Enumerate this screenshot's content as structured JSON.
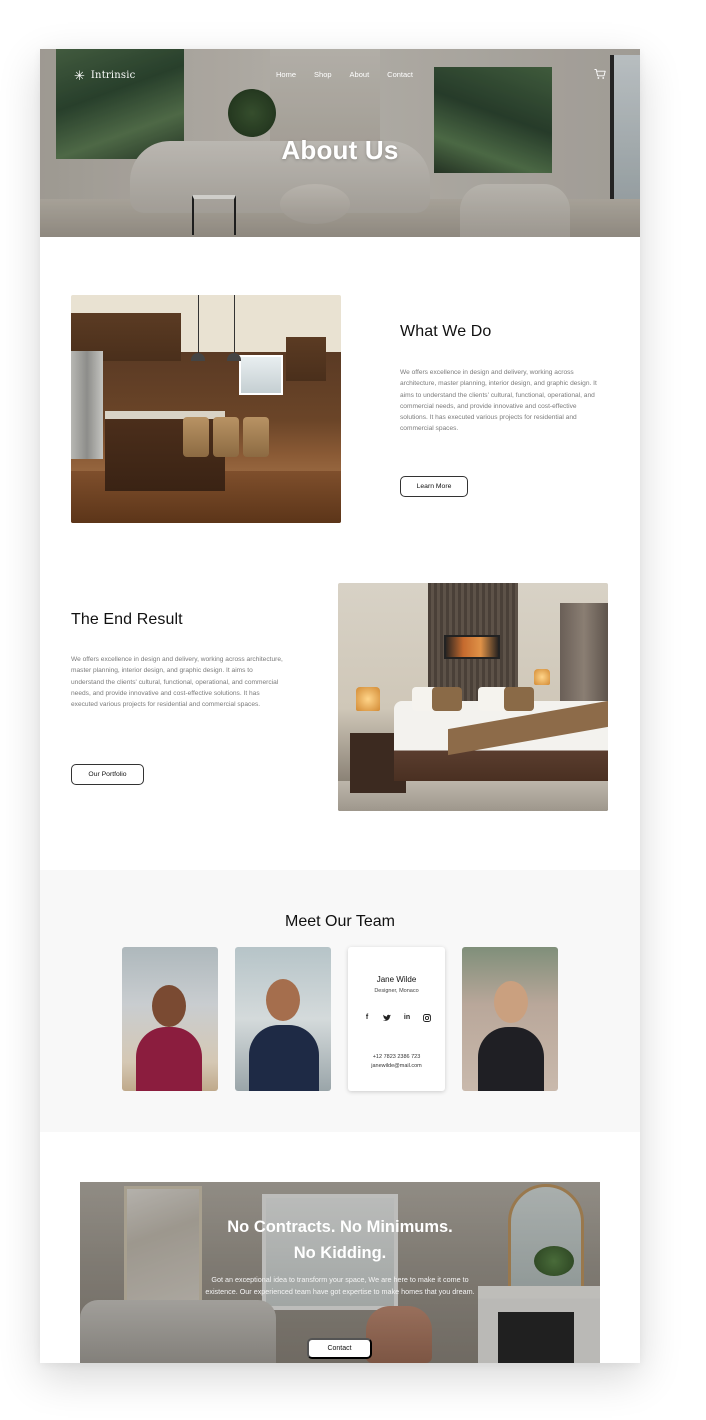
{
  "header": {
    "logo_icon": "✳",
    "logo_text": "Intrinsic",
    "nav": [
      "Home",
      "Shop",
      "About",
      "Contact"
    ],
    "cart_icon": "cart-icon",
    "title": "About Us"
  },
  "what_we_do": {
    "title": "What We Do",
    "text": "We offers excellence in design and delivery, working across architecture, master planning, interior design, and graphic design. It aims to understand the clients' cultural, functional, operational, and commercial needs, and provide innovative and cost-effective solutions. It has executed various projects for residential and commercial spaces.",
    "button": "Learn More"
  },
  "end_result": {
    "title": "The End Result",
    "text": "We offers excellence in design and delivery, working across architecture, master planning, interior design, and graphic design. It aims to understand the clients' cultural, functional, operational, and commercial needs, and provide innovative and cost-effective solutions. It has executed various projects for residential and commercial spaces.",
    "button": "Our Portfolio"
  },
  "team": {
    "title": "Meet Our Team",
    "featured": {
      "name": "Jane Wilde",
      "role": "Designer, Monaco",
      "phone": "+12 7823 2386 723",
      "email": "janewilde@mail.com",
      "social": [
        "facebook-icon",
        "twitter-icon",
        "linkedin-icon",
        "instagram-icon"
      ]
    }
  },
  "cta": {
    "title_line1": "No Contracts. No Minimums.",
    "title_line2": "No Kidding.",
    "text": "Got an exceptional idea to transform your space, We are here to make it come to existence. Our experienced team have got expertise to make homes that you dream.",
    "button": "Contact"
  },
  "colors": {
    "accent_text": "#111111",
    "body_text": "#7b7b7b",
    "team_bg": "#f8f8f8"
  }
}
